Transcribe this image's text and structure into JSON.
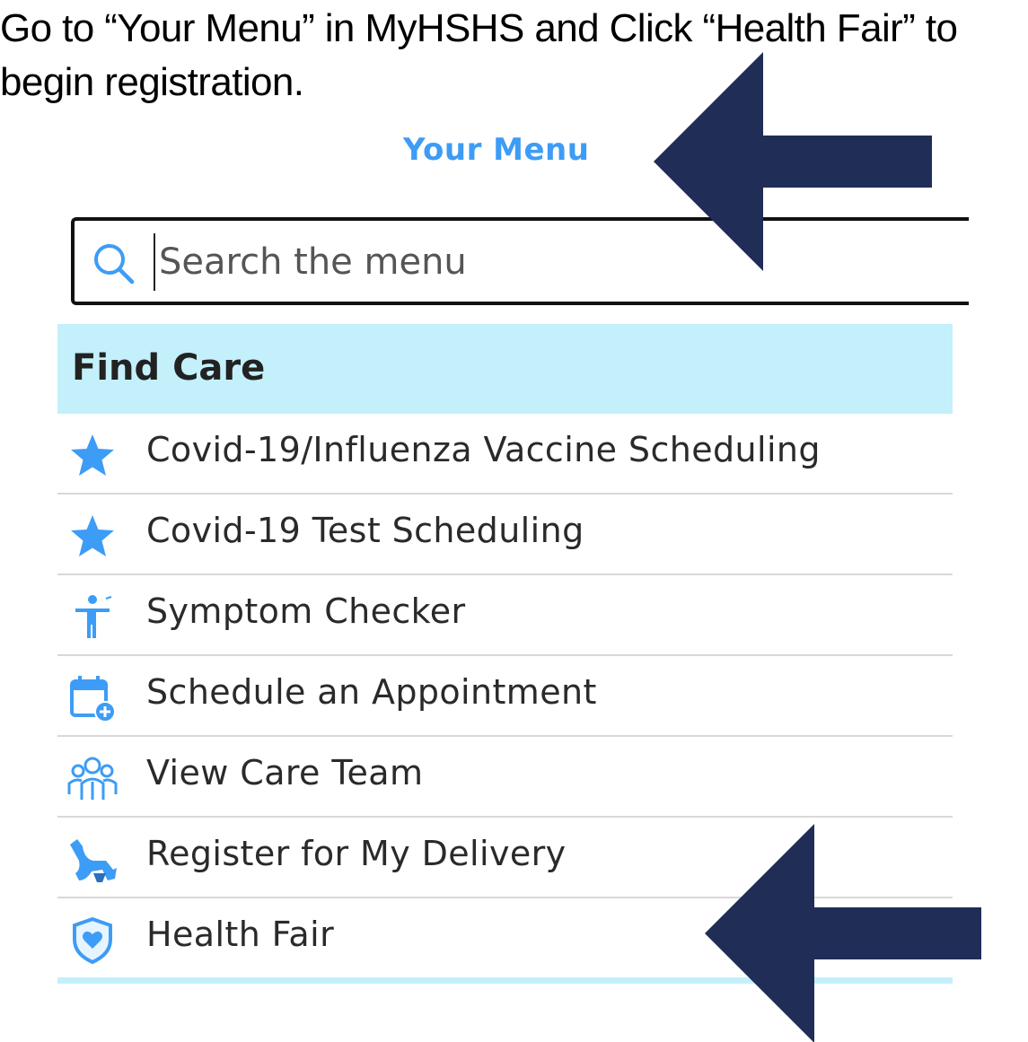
{
  "instruction": {
    "line1": "Go to “Your Menu” in MyHSHS and Click “Health Fair” to",
    "line2": "begin registration."
  },
  "menu": {
    "title": "Your Menu",
    "search_placeholder": "Search the menu",
    "section_title": "Find Care",
    "items": [
      {
        "label": "Covid-19/Influenza Vaccine Scheduling",
        "icon": "star-icon"
      },
      {
        "label": "Covid-19 Test Scheduling",
        "icon": "star-icon"
      },
      {
        "label": "Symptom Checker",
        "icon": "person-icon"
      },
      {
        "label": "Schedule an Appointment",
        "icon": "calendar-plus-icon"
      },
      {
        "label": "View Care Team",
        "icon": "team-icon"
      },
      {
        "label": "Register for My Delivery",
        "icon": "stork-icon"
      },
      {
        "label": "Health Fair",
        "icon": "heart-shield-icon"
      }
    ]
  },
  "colors": {
    "accent_blue": "#3d9cf5",
    "header_bg": "#c3f0fb",
    "arrow_navy": "#1f2d57"
  }
}
